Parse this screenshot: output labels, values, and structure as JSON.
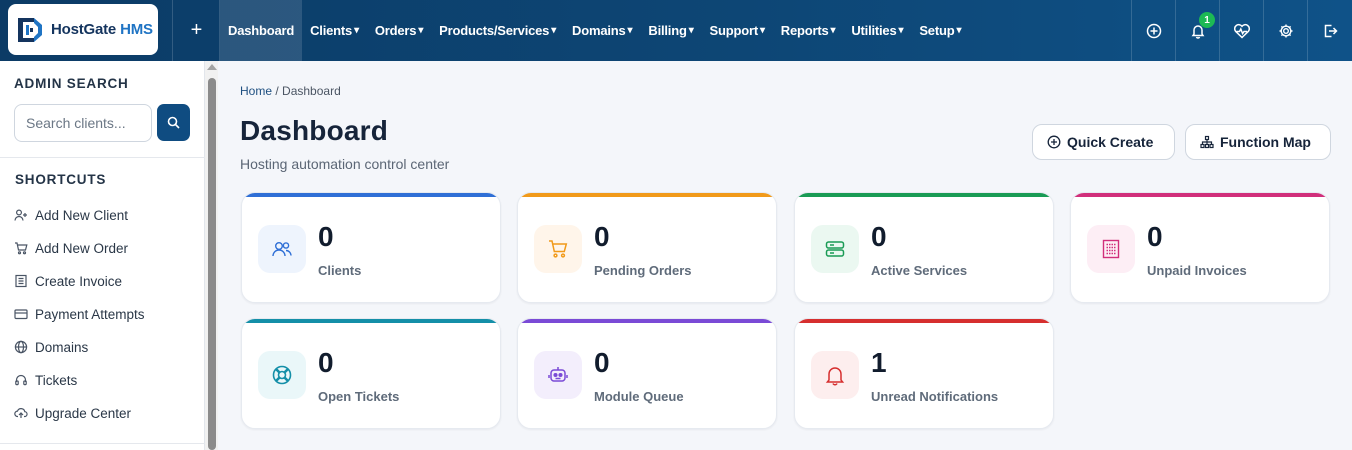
{
  "brand": {
    "name": "HostGate",
    "suffix": "HMS"
  },
  "nav": {
    "items": [
      {
        "label": "Dashboard",
        "caret": false,
        "active": true
      },
      {
        "label": "Clients",
        "caret": true
      },
      {
        "label": "Orders",
        "caret": true
      },
      {
        "label": "Products/Services",
        "caret": true
      },
      {
        "label": "Domains",
        "caret": true
      },
      {
        "label": "Billing",
        "caret": true
      },
      {
        "label": "Support",
        "caret": true
      },
      {
        "label": "Reports",
        "caret": true
      },
      {
        "label": "Utilities",
        "caret": true
      },
      {
        "label": "Setup",
        "caret": true
      }
    ],
    "caret_glyph": "▾",
    "plus": "+",
    "notification_count": "1",
    "icons": [
      "plus-circle-icon",
      "bell-icon",
      "heartbeat-icon",
      "gear-icon",
      "logout-icon"
    ]
  },
  "sidebar": {
    "admin_search_title": "ADMIN SEARCH",
    "search_placeholder": "Search clients...",
    "shortcuts_title": "SHORTCUTS",
    "shortcuts": [
      {
        "label": "Add New Client",
        "icon": "user-plus-icon"
      },
      {
        "label": "Add New Order",
        "icon": "cart-icon"
      },
      {
        "label": "Create Invoice",
        "icon": "invoice-icon"
      },
      {
        "label": "Payment Attempts",
        "icon": "credit-card-icon"
      },
      {
        "label": "Domains",
        "icon": "globe-icon"
      },
      {
        "label": "Tickets",
        "icon": "headset-icon"
      },
      {
        "label": "Upgrade Center",
        "icon": "cloud-upload-icon"
      }
    ]
  },
  "main": {
    "breadcrumb": {
      "home": "Home",
      "separator": " / ",
      "current": "Dashboard"
    },
    "title": "Dashboard",
    "subtitle": "Hosting automation control center",
    "quick_create": "Quick Create",
    "function_map": "Function Map",
    "cards": [
      {
        "value": "0",
        "label": "Clients",
        "color": "#2f6fd6",
        "bg": "#eef4fd",
        "icon": "users-icon"
      },
      {
        "value": "0",
        "label": "Pending Orders",
        "color": "#f19a1a",
        "bg": "#fff5ea",
        "icon": "cart-icon"
      },
      {
        "value": "0",
        "label": "Active Services",
        "color": "#1a9b55",
        "bg": "#ebf8f1",
        "icon": "server-icon"
      },
      {
        "value": "0",
        "label": "Unpaid Invoices",
        "color": "#d12f7b",
        "bg": "#fdeef5",
        "icon": "invoice-icon"
      },
      {
        "value": "0",
        "label": "Open Tickets",
        "color": "#148fa8",
        "bg": "#eaf7f9",
        "icon": "lifebuoy-icon"
      },
      {
        "value": "0",
        "label": "Module Queue",
        "color": "#7a4ad6",
        "bg": "#f3eefc",
        "icon": "robot-icon"
      },
      {
        "value": "1",
        "label": "Unread Notifications",
        "color": "#d62f2f",
        "bg": "#fdeeee",
        "icon": "bell-icon"
      }
    ]
  }
}
